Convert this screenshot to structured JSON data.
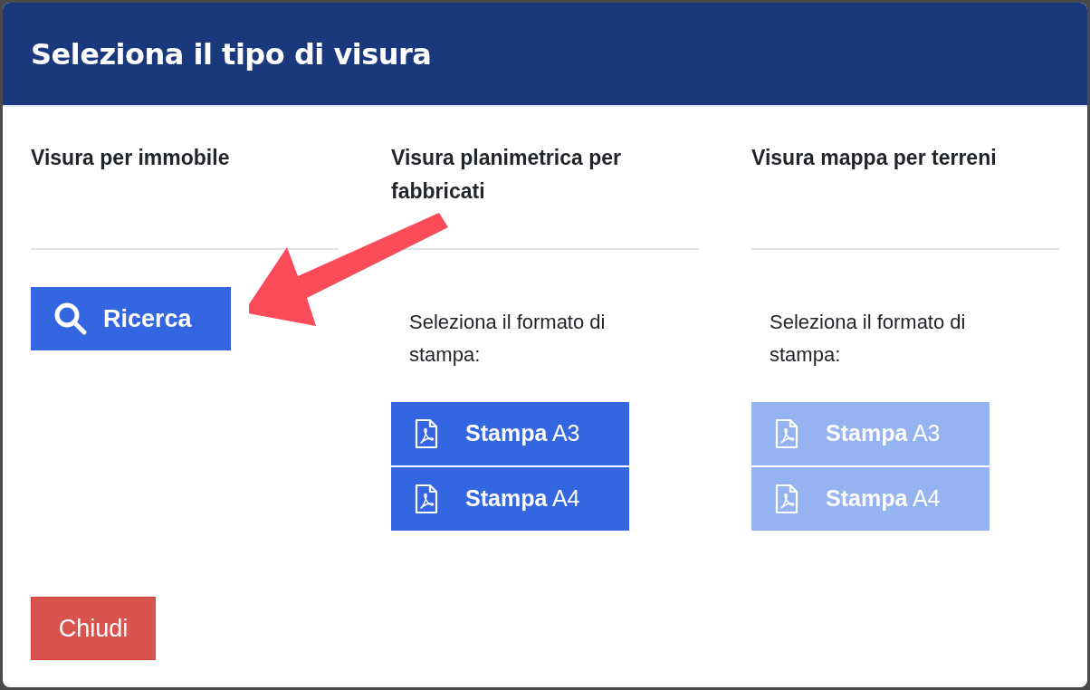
{
  "dialog": {
    "title": "Seleziona il tipo di visura",
    "columns": [
      {
        "kind": "search",
        "heading": "Visura per immobile",
        "button": {
          "label": "Ricerca"
        }
      },
      {
        "kind": "print",
        "heading": "Visura planimetrica per fabbricati",
        "prompt": "Seleziona il formato di stampa:",
        "buttons": [
          {
            "label": "**Stampa** A3",
            "disabled": false
          },
          {
            "label": "**Stampa** A4",
            "disabled": false
          }
        ]
      },
      {
        "kind": "print",
        "heading": "Visura mappa per terreni",
        "prompt": "Seleziona il formato di stampa:",
        "buttons": [
          {
            "label": "**Stampa** A3",
            "disabled": true
          },
          {
            "label": "**Stampa** A4",
            "disabled": true
          }
        ]
      }
    ],
    "close_button": "Chiudi"
  }
}
